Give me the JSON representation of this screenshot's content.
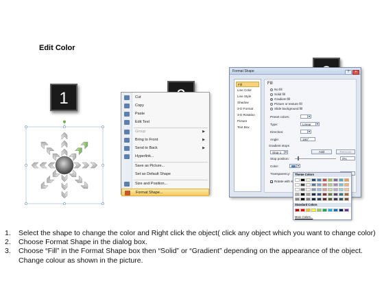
{
  "title": "Edit Color",
  "badges": [
    "1",
    "2",
    "3"
  ],
  "context_menu": {
    "items": [
      {
        "label": "Cut",
        "icon": "scissors-icon",
        "underline": "t"
      },
      {
        "label": "Copy",
        "icon": "copy-icon"
      },
      {
        "label": "Paste",
        "icon": "paste-icon"
      },
      {
        "label": "Edit Text",
        "icon": "edit-text-icon"
      },
      {
        "label": "Group",
        "icon": "group-icon",
        "submenu": true,
        "disabled": true
      },
      {
        "label": "Bring to Front",
        "icon": "bring-to-front-icon",
        "submenu": true
      },
      {
        "label": "Send to Back",
        "icon": "send-to-back-icon",
        "submenu": true
      },
      {
        "label": "Hyperlink...",
        "icon": "hyperlink-icon"
      },
      {
        "label": "Save as Picture...",
        "icon": ""
      },
      {
        "label": "Set as Default Shape",
        "icon": ""
      },
      {
        "label": "Size and Position...",
        "icon": "size-position-icon"
      },
      {
        "label": "Format Shape...",
        "icon": "format-shape-icon",
        "highlighted": true
      }
    ]
  },
  "dialog": {
    "title": "Format Shape",
    "nav": [
      "Fill",
      "Line Color",
      "Line Style",
      "Shadow",
      "3-D Format",
      "3-D Rotation",
      "Picture",
      "Text Box"
    ],
    "nav_selected": "Fill",
    "panel_heading": "Fill",
    "fill_options": [
      {
        "label": "No fill",
        "selected": false
      },
      {
        "label": "Solid fill",
        "selected": false
      },
      {
        "label": "Gradient fill",
        "selected": true
      },
      {
        "label": "Picture or texture fill",
        "selected": false
      },
      {
        "label": "Slide background fill",
        "selected": false
      }
    ],
    "preset_colors_label": "Preset colors:",
    "type_label": "Type:",
    "type_value": "Linear",
    "direction_label": "Direction:",
    "angle_label": "Angle:",
    "angle_value": "190°",
    "gradient_stops_label": "Gradient stops",
    "stop_value": "Stop 1",
    "add_label": "Add",
    "remove_label": "Remove",
    "stop_position_label": "Stop position:",
    "stop_position_value": "0%",
    "color_label": "Color:",
    "transparency_label": "Transparency:",
    "transparency_value": "0%",
    "rotate_label": "Rotate with shape"
  },
  "palette": {
    "theme_label": "Theme Colors",
    "standard_label": "Standard Colors",
    "more_label": "More Colors...",
    "theme_top": [
      "#ffffff",
      "#000000",
      "#eeece1",
      "#1f497d",
      "#4f81bd",
      "#c0504d",
      "#9bbb59",
      "#8064a2",
      "#4bacc6",
      "#f79646"
    ],
    "standard": [
      "#c00000",
      "#ff0000",
      "#ffc000",
      "#ffff00",
      "#92d050",
      "#00b050",
      "#00b0f0",
      "#0070c0",
      "#002060",
      "#7030a0"
    ]
  },
  "instructions": [
    {
      "n": "1.",
      "text": "Select the shape to change the color and Right click the object( click any object which you want to change color)"
    },
    {
      "n": "2.",
      "text": "Choose Format Shape in the dialog box."
    },
    {
      "n": "3.",
      "text": "Choose “Fill” in the Format Shape box then “Solid” or “Gradient” depending on the appearance of the object. Change colour as shown in the picture."
    }
  ]
}
